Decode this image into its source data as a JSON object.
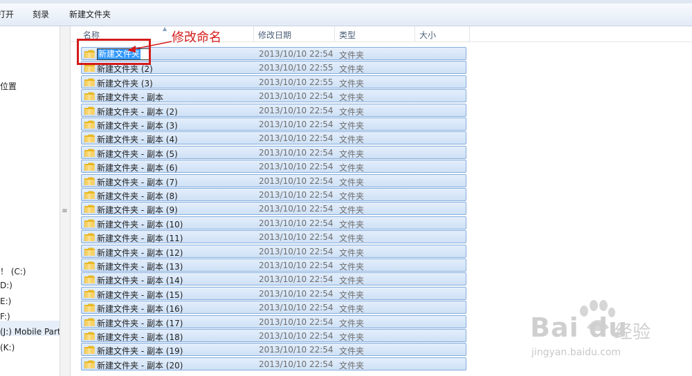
{
  "toolbar": {
    "open_label": "打开",
    "burn_label": "刻录",
    "new_folder_label": "新建文件夹"
  },
  "nav": {
    "items": [
      {
        "label": "位置"
      },
      {
        "label": "！ (C:)"
      },
      {
        "label": "D:)"
      },
      {
        "label": "E:)"
      },
      {
        "label": "F:)"
      },
      {
        "label": "(J:) Mobile Part"
      },
      {
        "label": " (K:)"
      }
    ]
  },
  "columns": {
    "name": "名称",
    "date": "修改日期",
    "type": "类型",
    "size": "大小"
  },
  "rename": {
    "value": "新建文件夹"
  },
  "annotation": {
    "text": "修改命名"
  },
  "rows": [
    {
      "name": "",
      "date": "2013/10/10 22:54",
      "type": "文件夹"
    },
    {
      "name": "新建文件夹 (2)",
      "date": "2013/10/10 22:55",
      "type": "文件夹"
    },
    {
      "name": "新建文件夹 (3)",
      "date": "2013/10/10 22:55",
      "type": "文件夹"
    },
    {
      "name": "新建文件夹 - 副本",
      "date": "2013/10/10 22:54",
      "type": "文件夹"
    },
    {
      "name": "新建文件夹 - 副本 (2)",
      "date": "2013/10/10 22:54",
      "type": "文件夹"
    },
    {
      "name": "新建文件夹 - 副本 (3)",
      "date": "2013/10/10 22:54",
      "type": "文件夹"
    },
    {
      "name": "新建文件夹 - 副本 (4)",
      "date": "2013/10/10 22:54",
      "type": "文件夹"
    },
    {
      "name": "新建文件夹 - 副本 (5)",
      "date": "2013/10/10 22:54",
      "type": "文件夹"
    },
    {
      "name": "新建文件夹 - 副本 (6)",
      "date": "2013/10/10 22:54",
      "type": "文件夹"
    },
    {
      "name": "新建文件夹 - 副本 (7)",
      "date": "2013/10/10 22:54",
      "type": "文件夹"
    },
    {
      "name": "新建文件夹 - 副本 (8)",
      "date": "2013/10/10 22:54",
      "type": "文件夹"
    },
    {
      "name": "新建文件夹 - 副本 (9)",
      "date": "2013/10/10 22:54",
      "type": "文件夹"
    },
    {
      "name": "新建文件夹 - 副本 (10)",
      "date": "2013/10/10 22:54",
      "type": "文件夹"
    },
    {
      "name": "新建文件夹 - 副本 (11)",
      "date": "2013/10/10 22:54",
      "type": "文件夹"
    },
    {
      "name": "新建文件夹 - 副本 (12)",
      "date": "2013/10/10 22:54",
      "type": "文件夹"
    },
    {
      "name": "新建文件夹 - 副本 (13)",
      "date": "2013/10/10 22:54",
      "type": "文件夹"
    },
    {
      "name": "新建文件夹 - 副本 (14)",
      "date": "2013/10/10 22:54",
      "type": "文件夹"
    },
    {
      "name": "新建文件夹 - 副本 (15)",
      "date": "2013/10/10 22:54",
      "type": "文件夹"
    },
    {
      "name": "新建文件夹 - 副本 (16)",
      "date": "2013/10/10 22:54",
      "type": "文件夹"
    },
    {
      "name": "新建文件夹 - 副本 (17)",
      "date": "2013/10/10 22:54",
      "type": "文件夹"
    },
    {
      "name": "新建文件夹 - 副本 (18)",
      "date": "2013/10/10 22:54",
      "type": "文件夹"
    },
    {
      "name": "新建文件夹 - 副本 (19)",
      "date": "2013/10/10 22:54",
      "type": "文件夹"
    },
    {
      "name": "新建文件夹 - 副本 (20)",
      "date": "2013/10/10 22:54",
      "type": "文件夹"
    }
  ],
  "watermark": {
    "brand": "Bai du",
    "cn": "经验",
    "url": "jingyan.baidu.com"
  },
  "colors": {
    "selection_bg": "#cfe1f6",
    "selection_border": "#84acdd",
    "annotation_red": "#d51a1a"
  }
}
